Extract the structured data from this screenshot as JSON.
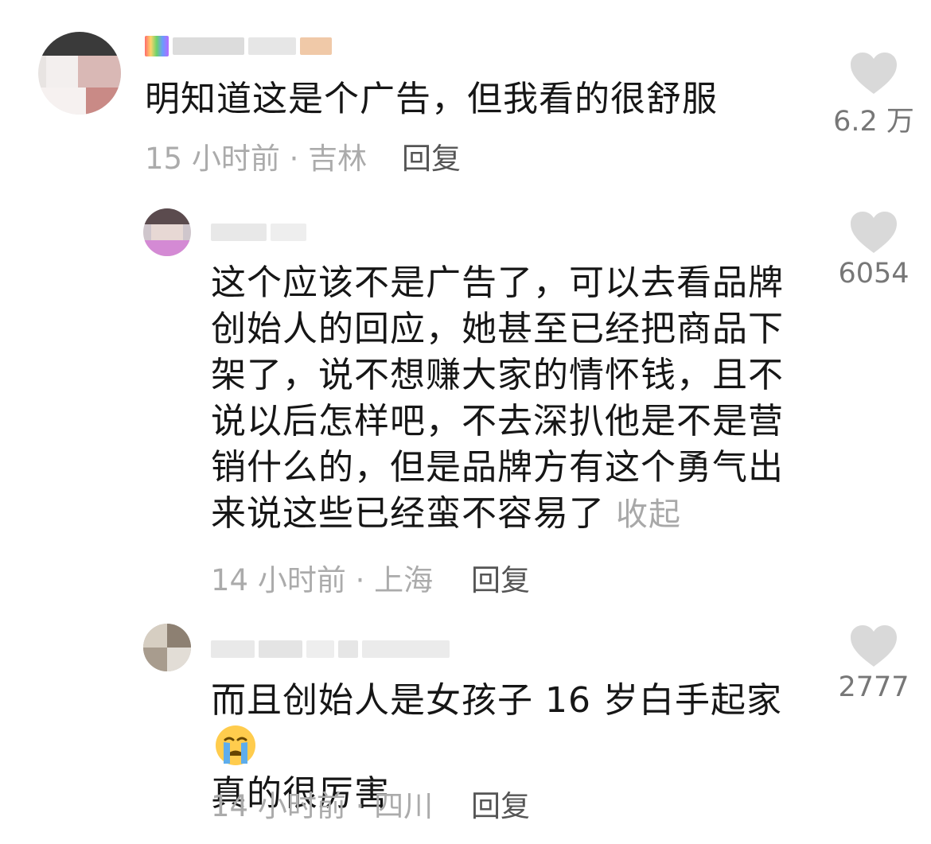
{
  "comments": [
    {
      "text": "明知道这是个广告，但我看的很舒服",
      "time": "15 小时前 · 吉林",
      "reply_label": "回复",
      "likes": "6.2 万"
    },
    {
      "text": "这个应该不是广告了，可以去看品牌创始人的回应，她甚至已经把商品下架了，说不想赚大家的情怀钱，且不说以后怎样吧，不去深扒他是不是营销什么的，但是品牌方有这个勇气出来说这些已经蛮不容易了",
      "collapse_label": "收起",
      "time": "14 小时前 · 上海",
      "reply_label": "回复",
      "likes": "6054"
    },
    {
      "text": "而且创始人是女孩子 16 岁白手起家",
      "text_after_emoji": "真的很厉害",
      "emoji": "crying-face",
      "time": "14 小时前 · 四川",
      "reply_label": "回复",
      "likes": "2777"
    }
  ],
  "colors": {
    "text": "#161616",
    "meta": "#ababab",
    "reply": "#555555",
    "heart": "#d9d9d9",
    "like_count": "#777777"
  }
}
